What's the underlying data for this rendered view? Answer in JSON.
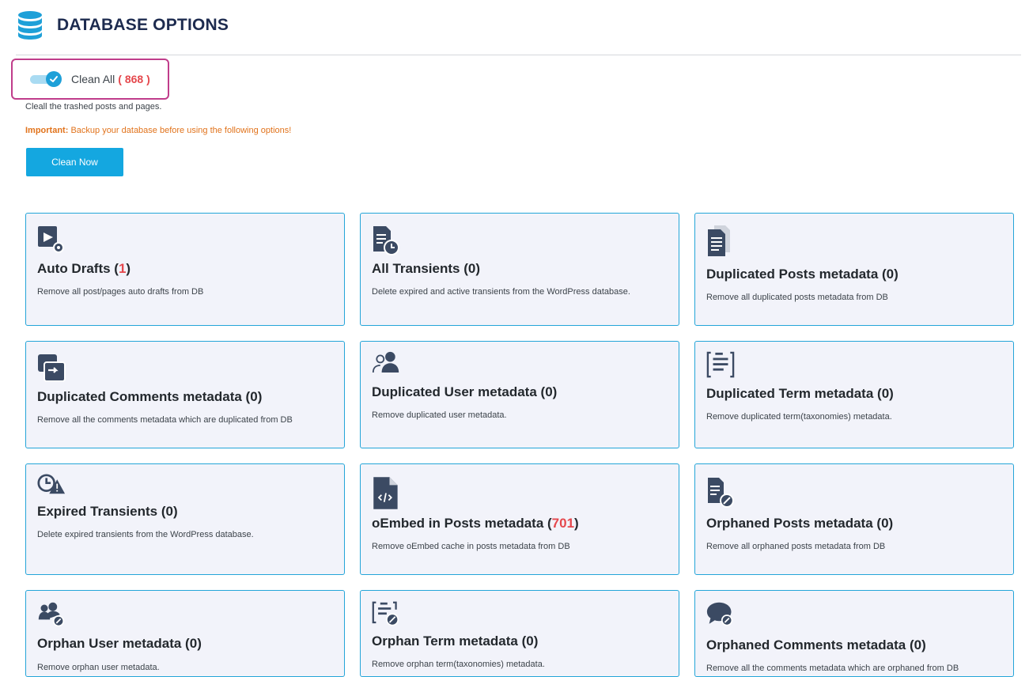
{
  "header": {
    "title": "DATABASE OPTIONS",
    "icon": "database-icon"
  },
  "clean_all": {
    "label": "Clean All",
    "count": "( 868 )",
    "enabled": true,
    "description": "Cleall the trashed posts and pages."
  },
  "important": {
    "label": "Important:",
    "text": " Backup your database before using the following options!"
  },
  "clean_now_label": "Clean Now",
  "colors": {
    "accent": "#14a7e0",
    "highlight": "#e5484d",
    "warning": "#e1731c",
    "frame": "#c03d8b"
  },
  "cards": [
    {
      "name": "Auto Drafts",
      "pre": "(",
      "count": "1",
      "post": ")",
      "highlight": true,
      "description": "Remove all post/pages auto drafts from DB",
      "icon": "auto-drafts-icon"
    },
    {
      "name": "All Transients",
      "pre": "(",
      "count": "0",
      "post": ")",
      "highlight": false,
      "description": "Delete expired and active transients from the WordPress database.",
      "icon": "transients-clock-icon"
    },
    {
      "name": "Duplicated Posts metadata",
      "pre": "(",
      "count": "0",
      "post": ")",
      "highlight": false,
      "description": "Remove all duplicated posts metadata from DB",
      "icon": "duplicate-document-icon"
    },
    {
      "name": "Duplicated Comments metadata",
      "pre": "(",
      "count": "0",
      "post": ")",
      "highlight": false,
      "description": "Remove all the comments metadata which are duplicated from DB",
      "icon": "duplicate-comments-icon"
    },
    {
      "name": "Duplicated User metadata",
      "pre": "(",
      "count": "0",
      "post": ")",
      "highlight": false,
      "description": "Remove duplicated user metadata.",
      "icon": "users-icon"
    },
    {
      "name": "Duplicated Term metadata",
      "pre": "(",
      "count": "0",
      "post": ")",
      "highlight": false,
      "description": "Remove duplicated term(taxonomies) metadata.",
      "icon": "term-list-icon"
    },
    {
      "name": "Expired Transients",
      "pre": "(",
      "count": "0",
      "post": ")",
      "highlight": false,
      "description": "Delete expired transients from the WordPress database.",
      "icon": "expired-warning-icon"
    },
    {
      "name": "oEmbed in Posts metadata",
      "pre": "(",
      "count": "701",
      "post": ")",
      "highlight": true,
      "description": "Remove oEmbed cache in posts metadata from DB",
      "icon": "code-file-icon"
    },
    {
      "name": "Orphaned Posts metadata",
      "pre": "(",
      "count": "0",
      "post": ")",
      "highlight": false,
      "description": "Remove all orphaned posts metadata from DB",
      "icon": "orphan-post-broom-icon"
    },
    {
      "name": "Orphan User metadata",
      "pre": "(",
      "count": "0",
      "post": ")",
      "highlight": false,
      "description": "Remove orphan user metadata.",
      "icon": "orphan-users-broom-icon"
    },
    {
      "name": "Orphan Term metadata",
      "pre": "(",
      "count": "0",
      "post": ")",
      "highlight": false,
      "description": "Remove orphan term(taxonomies) metadata.",
      "icon": "orphan-term-broom-icon"
    },
    {
      "name": "Orphaned Comments metadata",
      "pre": "(",
      "count": "0",
      "post": ")",
      "highlight": false,
      "description": "Remove all the comments metadata which are orphaned from DB",
      "icon": "orphan-comments-broom-icon"
    }
  ]
}
